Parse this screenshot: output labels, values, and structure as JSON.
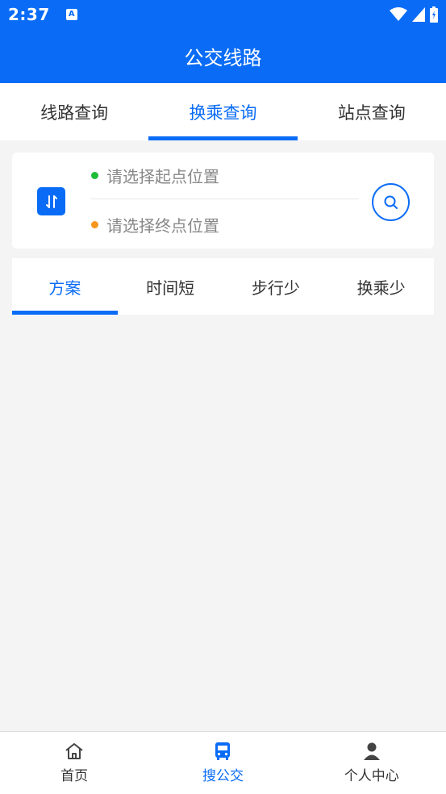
{
  "status": {
    "time": "2:37",
    "notif_icon": "A"
  },
  "title": "公交线路",
  "tabs": [
    {
      "label": "线路查询",
      "active": false
    },
    {
      "label": "换乘查询",
      "active": true
    },
    {
      "label": "站点查询",
      "active": false
    }
  ],
  "route": {
    "start_placeholder": "请选择起点位置",
    "end_placeholder": "请选择终点位置",
    "start_dot_color": "#1dbd3a",
    "end_dot_color": "#f5961e"
  },
  "sort_tabs": [
    {
      "label": "方案",
      "active": true
    },
    {
      "label": "时间短",
      "active": false
    },
    {
      "label": "步行少",
      "active": false
    },
    {
      "label": "换乘少",
      "active": false
    }
  ],
  "bottom_nav": [
    {
      "label": "首页",
      "icon": "home-icon",
      "active": false
    },
    {
      "label": "搜公交",
      "icon": "bus-icon",
      "active": true
    },
    {
      "label": "个人中心",
      "icon": "person-icon",
      "active": false
    }
  ],
  "colors": {
    "primary": "#0a6cf6",
    "background": "#f4f4f4"
  }
}
